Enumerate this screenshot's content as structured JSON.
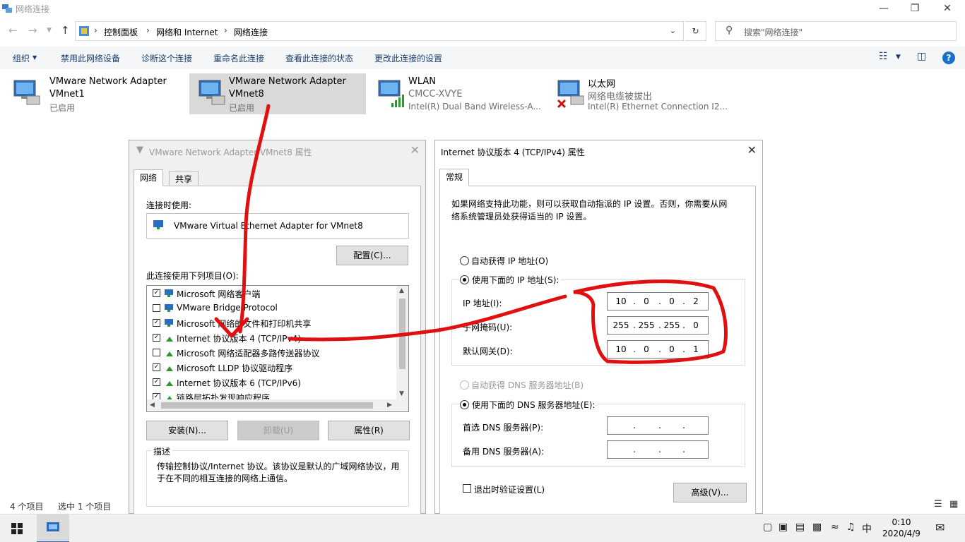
{
  "window": {
    "title": "网络连接"
  },
  "address": {
    "crumbs": [
      "控制面板",
      "网络和 Internet",
      "网络连接"
    ],
    "search_placeholder": "搜索\"网络连接\""
  },
  "toolbar": {
    "organize": "组织",
    "items": [
      "禁用此网络设备",
      "诊断这个连接",
      "重命名此连接",
      "查看此连接的状态",
      "更改此连接的设置"
    ]
  },
  "adapters": [
    {
      "name": "VMware Network Adapter",
      "line2": "VMnet1",
      "line3": "已启用"
    },
    {
      "name": "VMware Network Adapter",
      "line2": "VMnet8",
      "line3": "已启用"
    },
    {
      "name": "WLAN",
      "line2": "CMCC-XVYE",
      "line3": "Intel(R) Dual Band Wireless-A..."
    },
    {
      "name": "以太网",
      "line2": "网络电缆被拔出",
      "line3": "Intel(R) Ethernet Connection I2..."
    }
  ],
  "status": {
    "count": "4 个项目",
    "selected": "选中 1 个项目"
  },
  "props_dialog": {
    "title": "VMware Network Adapter VMnet8 属性",
    "tabs": [
      "网络",
      "共享"
    ],
    "connect_using_label": "连接时使用:",
    "adapter_name": "VMware Virtual Ethernet Adapter for VMnet8",
    "configure_button": "配置(C)...",
    "items_label": "此连接使用下列项目(O):",
    "items": [
      {
        "label": "Microsoft 网络客户端",
        "checked": true
      },
      {
        "label": "VMware Bridge Protocol",
        "checked": false
      },
      {
        "label": "Microsoft 网络的文件和打印机共享",
        "checked": true
      },
      {
        "label": "Internet 协议版本 4 (TCP/IPv4)",
        "checked": true
      },
      {
        "label": "Microsoft 网络适配器多路传送器协议",
        "checked": false
      },
      {
        "label": "Microsoft LLDP 协议驱动程序",
        "checked": true
      },
      {
        "label": "Internet 协议版本 6 (TCP/IPv6)",
        "checked": true
      },
      {
        "label": "链路层拓扑发现响应程序",
        "checked": true
      }
    ],
    "install_button": "安装(N)...",
    "uninstall_button": "卸载(U)",
    "properties_button": "属性(R)",
    "description_legend": "描述",
    "description": "传输控制协议/Internet 协议。该协议是默认的广域网络协议，用于在不同的相互连接的网络上通信。"
  },
  "ipv4_dialog": {
    "title": "Internet 协议版本 4 (TCP/IPv4) 属性",
    "tab": "常规",
    "intro": "如果网络支持此功能，则可以获取自动指派的 IP 设置。否则，你需要从网络系统管理员处获得适当的 IP 设置。",
    "auto_ip": "自动获得 IP 地址(O)",
    "manual_ip": "使用下面的 IP 地址(S):",
    "ip_label": "IP 地址(I):",
    "mask_label": "子网掩码(U):",
    "gateway_label": "默认网关(D):",
    "ip": [
      "10",
      "0",
      "0",
      "2"
    ],
    "mask": [
      "255",
      "255",
      "255",
      "0"
    ],
    "gateway": [
      "10",
      "0",
      "0",
      "1"
    ],
    "auto_dns": "自动获得 DNS 服务器地址(B)",
    "manual_dns": "使用下面的 DNS 服务器地址(E):",
    "pref_dns_label": "首选 DNS 服务器(P):",
    "alt_dns_label": "备用 DNS 服务器(A):",
    "validate_label": "退出时验证设置(L)",
    "advanced_button": "高级(V)..."
  },
  "taskbar": {
    "ime": "中",
    "time": "0:10",
    "date": "2020/4/9"
  },
  "colors": {
    "annotation": "#e01010",
    "selected_bg": "#d9d9d9",
    "toolbar_text": "#1a3e6e"
  }
}
